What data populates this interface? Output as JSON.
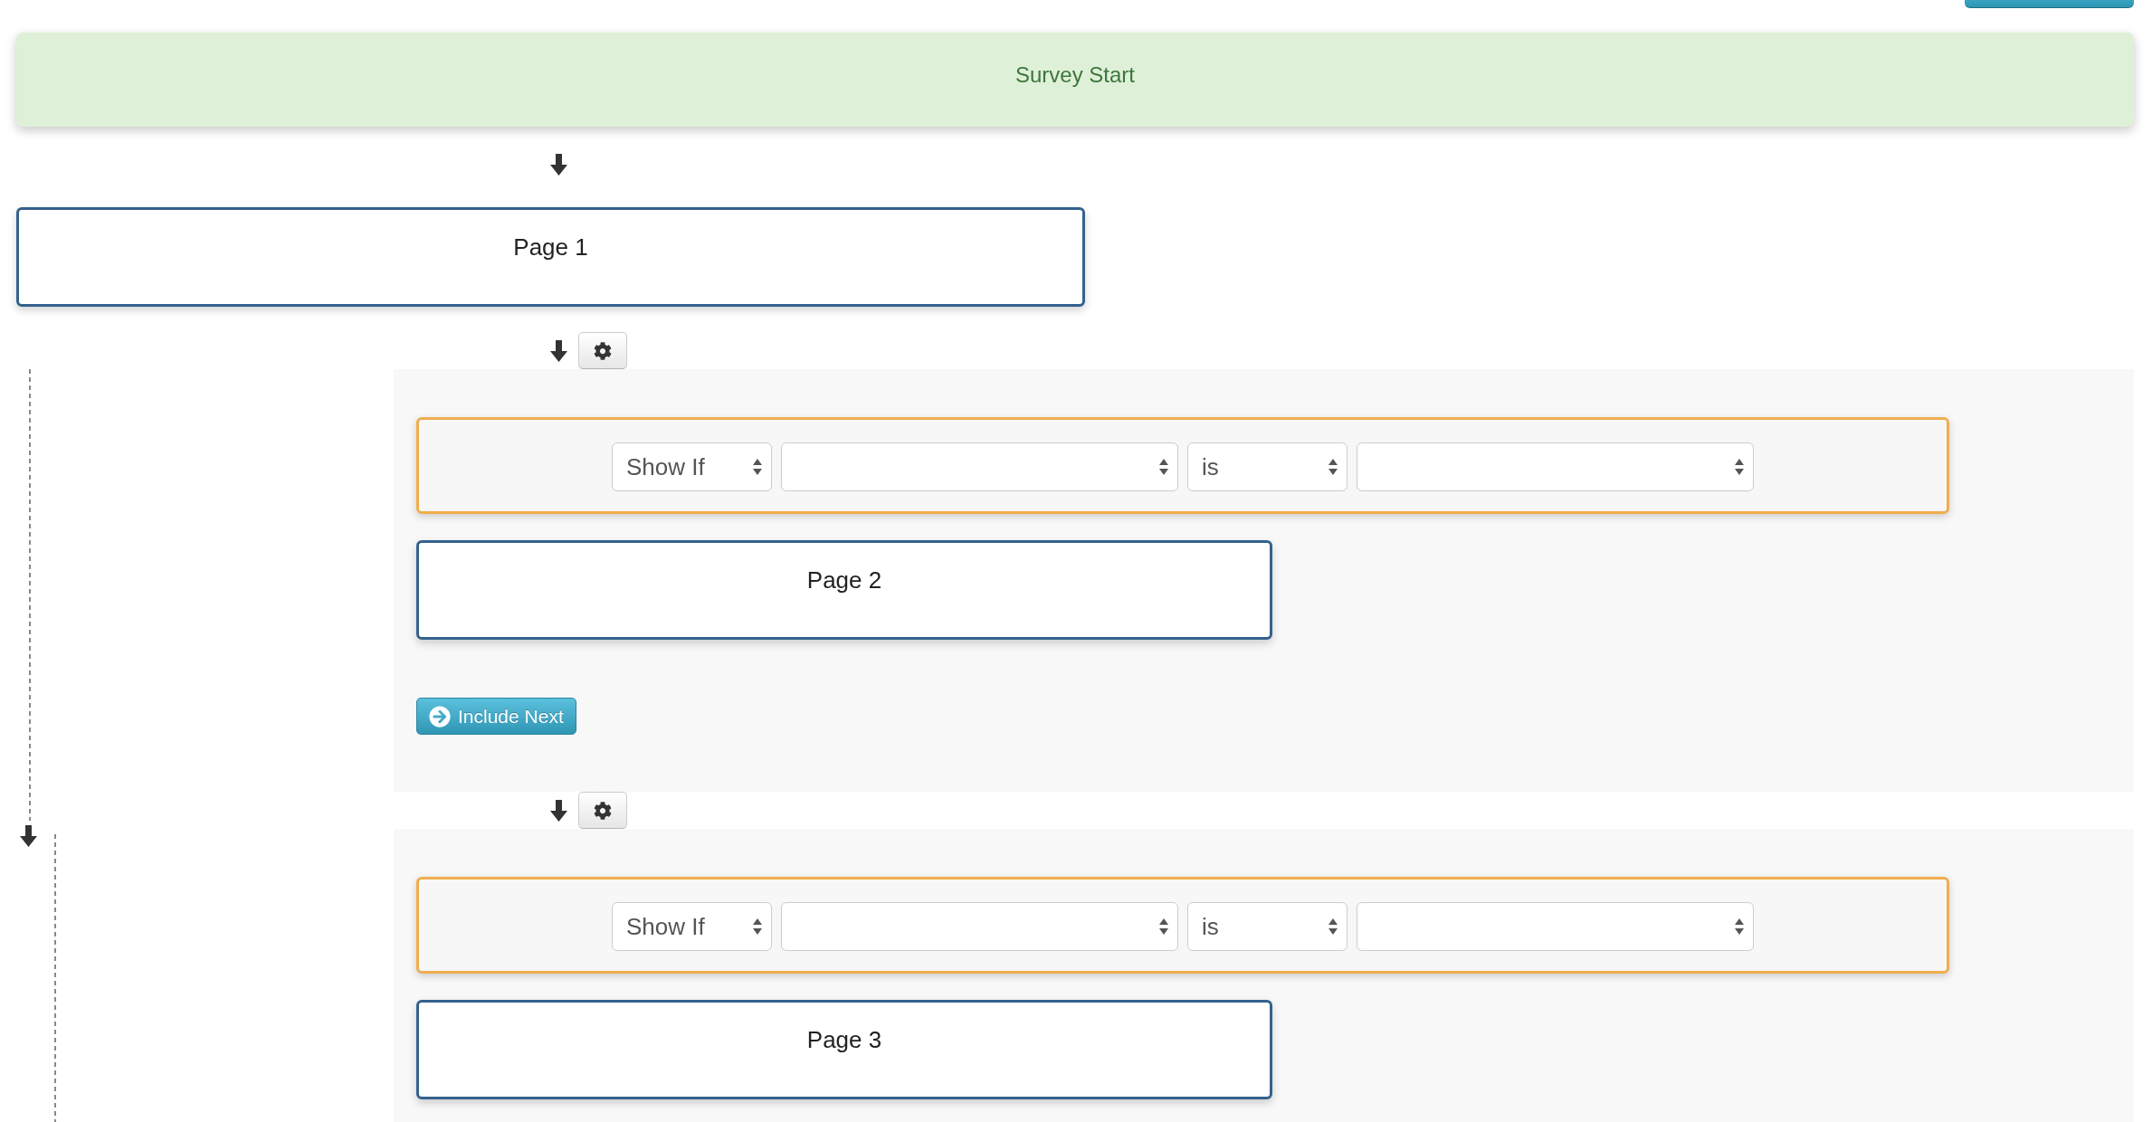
{
  "survey_start": {
    "label": "Survey Start"
  },
  "first_page": {
    "label": "Page 1"
  },
  "blocks": [
    {
      "condition": {
        "fields": [
          {
            "kind": "short",
            "value": "Show If"
          },
          {
            "kind": "long"
          },
          {
            "kind": "short",
            "value": "is"
          },
          {
            "kind": "long"
          }
        ]
      },
      "page": {
        "label": "Page 2"
      },
      "include_next": {
        "label": "Include Next"
      }
    },
    {
      "condition": {
        "fields": [
          {
            "kind": "short",
            "value": "Show If"
          },
          {
            "kind": "long"
          },
          {
            "kind": "short",
            "value": "is"
          },
          {
            "kind": "long"
          }
        ]
      },
      "page": {
        "label": "Page 3"
      }
    }
  ]
}
